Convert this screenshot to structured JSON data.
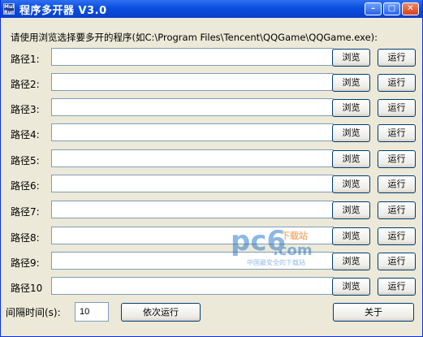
{
  "window": {
    "icon_text": "Mult Run",
    "title": "程序多开器 V3.0",
    "minimize": "–",
    "maximize": "□",
    "close": "✕"
  },
  "instruction": "请使用浏览选择要多开的程序(如C:\\Program Files\\Tencent\\QQGame\\QQGame.exe):",
  "rows": [
    {
      "label": "路径1:",
      "value": "",
      "browse": "浏览",
      "run": "运行"
    },
    {
      "label": "路径2:",
      "value": "",
      "browse": "浏览",
      "run": "运行"
    },
    {
      "label": "路径3:",
      "value": "",
      "browse": "浏览",
      "run": "运行"
    },
    {
      "label": "路径4:",
      "value": "",
      "browse": "浏览",
      "run": "运行"
    },
    {
      "label": "路径5:",
      "value": "",
      "browse": "浏览",
      "run": "运行"
    },
    {
      "label": "路径6:",
      "value": "",
      "browse": "浏览",
      "run": "运行"
    },
    {
      "label": "路径7:",
      "value": "",
      "browse": "浏览",
      "run": "运行"
    },
    {
      "label": "路径8:",
      "value": "",
      "browse": "浏览",
      "run": "运行"
    },
    {
      "label": "路径9:",
      "value": "",
      "browse": "浏览",
      "run": "运行"
    },
    {
      "label": "路径10",
      "value": "",
      "browse": "浏览",
      "run": "运行"
    }
  ],
  "footer": {
    "interval_label": "间隔时间(s):",
    "interval_value": "10",
    "sequential_run": "依次运行",
    "about": "关于"
  },
  "watermark": {
    "logo": "pc6",
    "com": ".com",
    "top": "下载站",
    "sub": "中国最安全的下载站"
  }
}
